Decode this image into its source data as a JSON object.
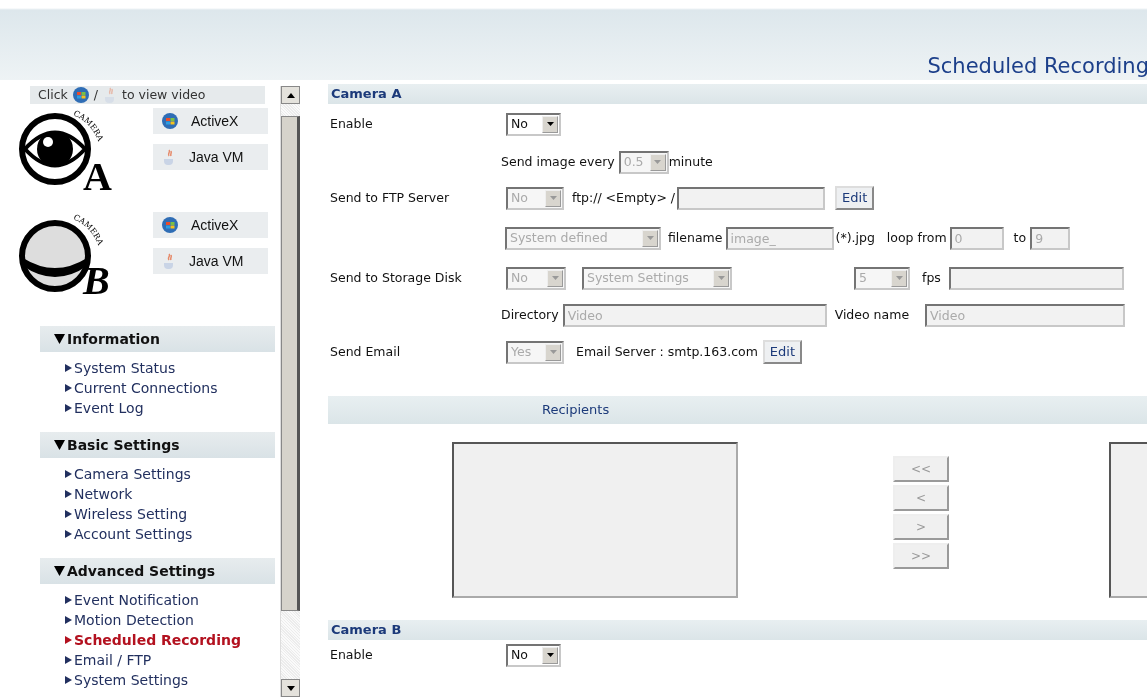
{
  "header": {
    "title": "Scheduled Recording"
  },
  "sidebar": {
    "hint": {
      "before": "Click",
      "separator": "/",
      "after": "to view video"
    },
    "cameras": [
      {
        "letter": "A",
        "logo_text": "CAMERA",
        "buttons": [
          {
            "kind": "activex",
            "label": "ActiveX"
          },
          {
            "kind": "java",
            "label": "Java VM"
          }
        ]
      },
      {
        "letter": "B",
        "logo_text": "CAMERA",
        "buttons": [
          {
            "kind": "activex",
            "label": "ActiveX"
          },
          {
            "kind": "java",
            "label": "Java VM"
          }
        ]
      }
    ],
    "menu": [
      {
        "title": "Information",
        "expanded": true,
        "items": [
          {
            "label": "System Status",
            "selected": false
          },
          {
            "label": "Current Connections",
            "selected": false
          },
          {
            "label": "Event Log",
            "selected": false
          }
        ]
      },
      {
        "title": "Basic Settings",
        "expanded": true,
        "items": [
          {
            "label": "Camera Settings",
            "selected": false
          },
          {
            "label": "Network",
            "selected": false
          },
          {
            "label": "Wireless Setting",
            "selected": false
          },
          {
            "label": "Account Settings",
            "selected": false
          }
        ]
      },
      {
        "title": "Advanced Settings",
        "expanded": true,
        "items": [
          {
            "label": "Event Notification",
            "selected": false
          },
          {
            "label": "Motion Detection",
            "selected": false
          },
          {
            "label": "Scheduled Recording",
            "selected": true
          },
          {
            "label": "Email / FTP",
            "selected": false
          },
          {
            "label": "System Settings",
            "selected": false
          }
        ]
      }
    ]
  },
  "camera_a": {
    "title": "Camera A",
    "enable": {
      "label": "Enable",
      "value": "No",
      "disabled": false
    },
    "send_image": {
      "label": "Send image every",
      "value": "0.5",
      "disabled": true,
      "unit": "minute"
    },
    "ftp": {
      "label": "Send to FTP Server",
      "value": "No",
      "disabled": true,
      "address": "ftp:// <Empty> /",
      "button": "Edit"
    },
    "file": {
      "naming": "System defined",
      "disabled": true,
      "filename_label": "filename",
      "filename": "image_",
      "extension": "(*).jpg",
      "loop_label": "loop from",
      "from": "0",
      "to_label": "to",
      "to": "9"
    },
    "storage": {
      "label": "Send to Storage Disk",
      "value": "No",
      "disabled": true,
      "profile": "System Settings",
      "fps_value": "5",
      "fps_label": "fps",
      "directory_label": "Directory",
      "directory": "Video",
      "video_name_label": "Video name",
      "video_name": "Video"
    },
    "email": {
      "label": "Send Email",
      "value": "Yes",
      "disabled": true,
      "server": "Email Server : smtp.163.com",
      "button": "Edit"
    },
    "recipients": {
      "title": "Recipients",
      "buttons": [
        "<<",
        "<",
        ">",
        ">>"
      ]
    }
  },
  "camera_b": {
    "title": "Camera B",
    "enable": {
      "label": "Enable",
      "value": "No",
      "disabled": false
    }
  }
}
